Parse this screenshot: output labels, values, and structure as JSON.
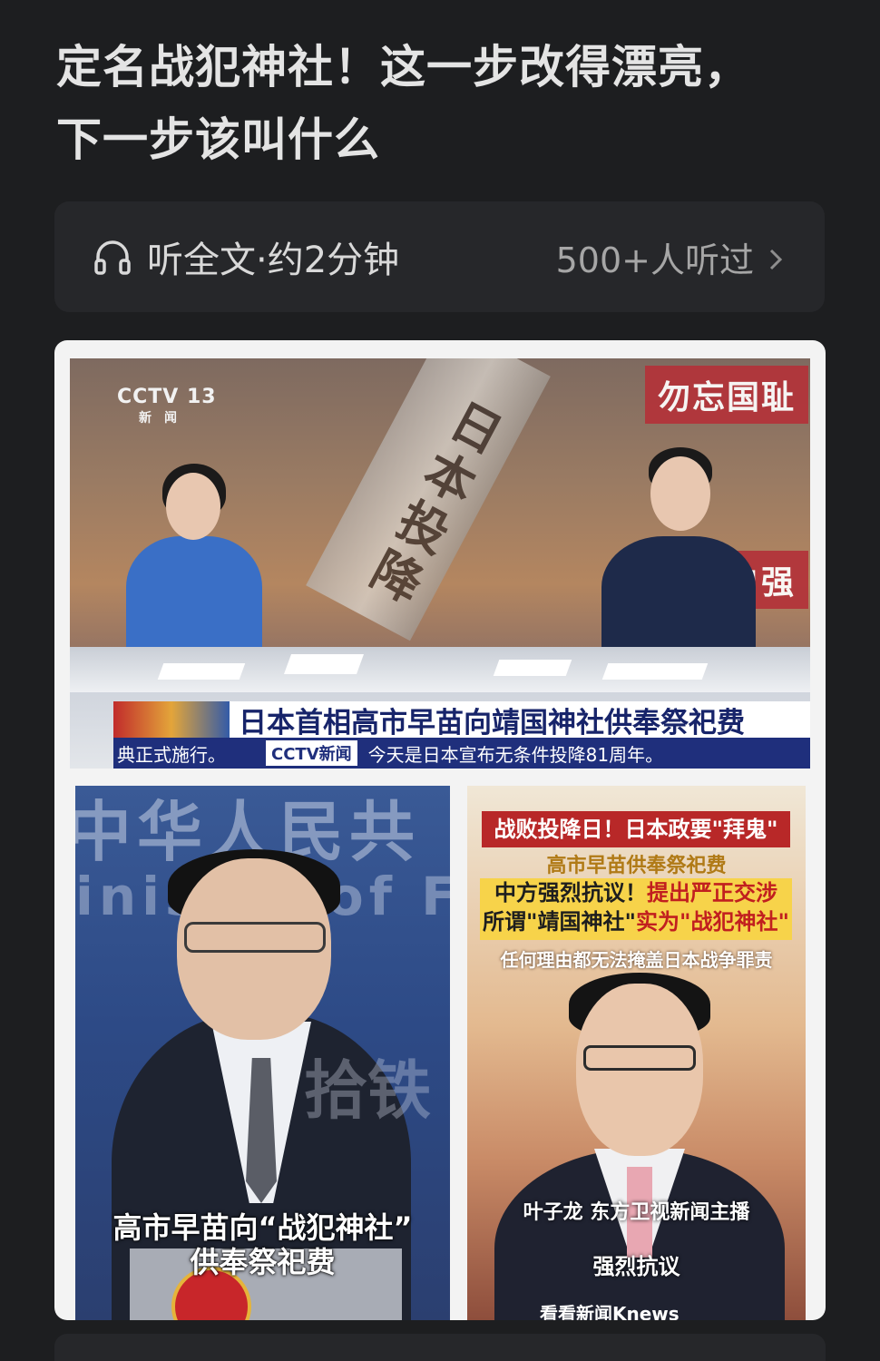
{
  "article": {
    "title_line1": "定名战犯神社！这一步改得漂亮，",
    "title_line2": "下一步该叫什么"
  },
  "listen": {
    "label": "听全文·约2分钟",
    "listeners": "500+人听过",
    "icon": "headphone-icon",
    "chevron_icon": "chevron-right-icon"
  },
  "image": {
    "frame1": {
      "channel_logo": "CCTV 13",
      "channel_sub": "新闻",
      "tag_left": "勿忘国耻",
      "tag_right": "吾辈自强",
      "scroll_text": "日本投降",
      "headline": "日本首相高市早苗向靖国神社供奉祭祀费",
      "ticker_left": "典正式施行。",
      "ticker_logo": "CCTV新闻",
      "ticker_right": "今天是日本宣布无条件投降81周年。"
    },
    "frame2": {
      "wall_line1": "中华人民共",
      "wall_line2": "inistry of Fo",
      "watermark": "拾铁",
      "caption_line1": "高市早苗向“战犯神社”",
      "caption_line2": "供奉祭祀费"
    },
    "frame3": {
      "headline": "战败投降日！日本政要\"拜鬼\"",
      "gold_line": "高市早苗供奉祭祀费",
      "yellow_line1_a": "中方强烈抗议！",
      "yellow_line1_b": "提出严正交涉",
      "yellow_line2_a": "所谓\"靖国神社\"",
      "yellow_line2_b": "实为\"战犯神社\"",
      "small_line": "任何理由都无法掩盖日本战争罪责",
      "anchor_name": "叶子龙 东方卫视新闻主播",
      "protest": "强烈抗议",
      "brand": "看看新闻Knews"
    }
  },
  "colors": {
    "background": "#1d1e20",
    "listen_bar": "#26272a",
    "tag_red": "#b3333a",
    "headline_blue": "#17246a"
  }
}
